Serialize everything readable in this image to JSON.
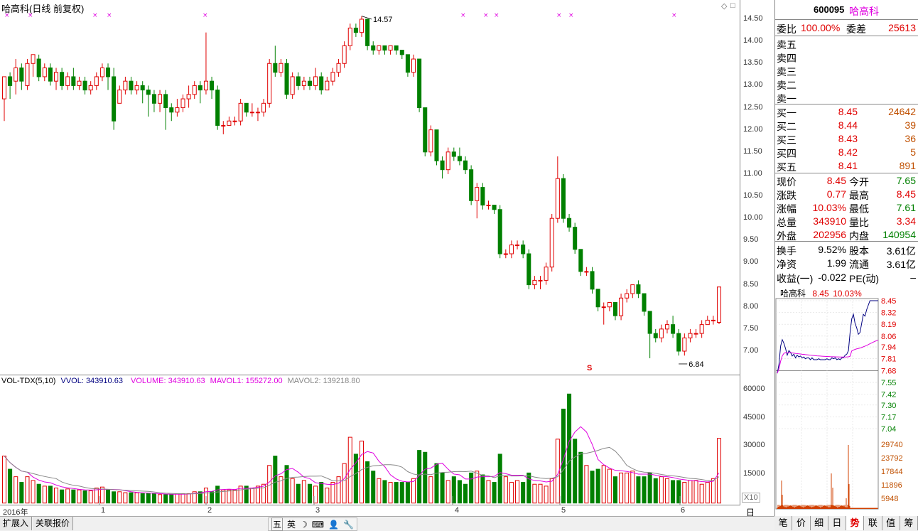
{
  "header": {
    "title": "哈高科(日线 前复权)"
  },
  "price_ticks": [
    "14.50",
    "14.00",
    "13.50",
    "13.00",
    "12.50",
    "12.00",
    "11.50",
    "11.00",
    "10.50",
    "10.00",
    "9.50",
    "9.00",
    "8.50",
    "8.00",
    "7.50",
    "7.00"
  ],
  "annotations": {
    "high": "14.57",
    "low": "6.84",
    "marker": "S"
  },
  "volume_header": {
    "name": "VOL-TDX(5,10)",
    "vvol": "VVOL: 343910.63",
    "volume": "VOLUME: 343910.63",
    "mavol1": "MAVOL1: 155272.00",
    "mavol2": "MAVOL2: 139218.80"
  },
  "vol_ticks": [
    "60000",
    "45000",
    "30000",
    "15000"
  ],
  "x10_label": "X10",
  "xaxis": [
    "2016年",
    "1",
    "2",
    "3",
    "4",
    "5",
    "6"
  ],
  "period_label": "日线",
  "bottom_tabs": [
    "扩展入",
    "关联报价"
  ],
  "ime": [
    "五",
    "英",
    "☽",
    "⌨",
    "👤",
    "🔧"
  ],
  "quote": {
    "code": "600095",
    "name": "哈高科",
    "weibi_label": "委比",
    "weibi": "100.00%",
    "weicha_label": "委差",
    "weicha": "25613",
    "sell": [
      {
        "label": "卖五"
      },
      {
        "label": "卖四"
      },
      {
        "label": "卖三"
      },
      {
        "label": "卖二"
      },
      {
        "label": "卖一"
      }
    ],
    "buy": [
      {
        "label": "买一",
        "price": "8.45",
        "vol": "24642"
      },
      {
        "label": "买二",
        "price": "8.44",
        "vol": "39"
      },
      {
        "label": "买三",
        "price": "8.43",
        "vol": "36"
      },
      {
        "label": "买四",
        "price": "8.42",
        "vol": "5"
      },
      {
        "label": "买五",
        "price": "8.41",
        "vol": "891"
      }
    ],
    "stats": [
      {
        "l1": "现价",
        "v1": "8.45",
        "c1": "red",
        "l2": "今开",
        "v2": "7.65",
        "c2": "green"
      },
      {
        "l1": "涨跌",
        "v1": "0.77",
        "c1": "red",
        "l2": "最高",
        "v2": "8.45",
        "c2": "red"
      },
      {
        "l1": "涨幅",
        "v1": "10.03%",
        "c1": "red",
        "l2": "最低",
        "v2": "7.61",
        "c2": "green"
      },
      {
        "l1": "总量",
        "v1": "343910",
        "c1": "red",
        "l2": "量比",
        "v2": "3.34",
        "c2": "red"
      },
      {
        "l1": "外盘",
        "v1": "202956",
        "c1": "red",
        "l2": "内盘",
        "v2": "140954",
        "c2": "green"
      },
      {
        "l1": "换手",
        "v1": "9.52%",
        "c1": "black",
        "l2": "股本",
        "v2": "3.61亿",
        "c2": "black"
      },
      {
        "l1": "净资",
        "v1": "1.99",
        "c1": "black",
        "l2": "流通",
        "v2": "3.61亿",
        "c2": "black"
      },
      {
        "l1": "收益(一)",
        "v1": "-0.022",
        "c1": "black",
        "l2": "PE(动)",
        "v2": "–",
        "c2": "black"
      }
    ]
  },
  "mini": {
    "name": "哈高科",
    "price": "8.45",
    "pct": "10.03%",
    "price_ticks": [
      "8.45",
      "8.32",
      "8.19",
      "8.06",
      "7.94",
      "7.81",
      "7.68",
      "7.55",
      "7.42",
      "7.30",
      "7.17",
      "7.04"
    ],
    "vol_ticks": [
      "29740",
      "23792",
      "17844",
      "11896",
      "5948"
    ]
  },
  "side_tabs": [
    "笔",
    "价",
    "细",
    "日",
    "势",
    "联",
    "值",
    "筹"
  ],
  "colors": {
    "up": "#e00000",
    "down": "#008000",
    "ma1": "#e000e0",
    "ma2": "#888888"
  },
  "chart_data": {
    "type": "candlestick",
    "ylim": [
      6.6,
      14.7
    ],
    "candles": [
      [
        12.7,
        13.2,
        12.2,
        13.2
      ],
      [
        13.2,
        13.0,
        12.7,
        13.3
      ],
      [
        13.1,
        13.4,
        12.8,
        13.6
      ],
      [
        13.4,
        13.1,
        12.9,
        13.5
      ],
      [
        13.0,
        13.5,
        12.9,
        13.6
      ],
      [
        13.5,
        13.7,
        13.2,
        13.7
      ],
      [
        13.6,
        13.2,
        13.1,
        13.7
      ],
      [
        13.2,
        13.4,
        13.1,
        13.5
      ],
      [
        13.4,
        13.1,
        13.0,
        13.5
      ],
      [
        13.1,
        13.3,
        12.9,
        13.4
      ],
      [
        13.3,
        13.0,
        12.9,
        13.4
      ],
      [
        13.0,
        13.2,
        12.9,
        13.3
      ],
      [
        13.2,
        13.0,
        12.9,
        13.4
      ],
      [
        13.0,
        13.1,
        12.9,
        13.2
      ],
      [
        13.1,
        12.9,
        12.8,
        13.2
      ],
      [
        12.9,
        13.0,
        12.8,
        13.1
      ],
      [
        13.0,
        13.2,
        12.9,
        13.3
      ],
      [
        13.2,
        13.4,
        13.1,
        13.5
      ],
      [
        13.4,
        13.2,
        12.9,
        13.5
      ],
      [
        13.2,
        12.2,
        12.0,
        13.4
      ],
      [
        12.6,
        12.9,
        12.6,
        13.0
      ],
      [
        12.9,
        13.1,
        12.8,
        13.2
      ],
      [
        13.1,
        12.9,
        12.8,
        13.2
      ],
      [
        12.9,
        13.0,
        12.8,
        13.1
      ],
      [
        13.0,
        12.9,
        12.6,
        13.1
      ],
      [
        12.9,
        12.8,
        12.3,
        13.0
      ],
      [
        12.8,
        12.6,
        12.4,
        12.9
      ],
      [
        12.6,
        12.8,
        12.4,
        12.9
      ],
      [
        12.8,
        12.5,
        12.0,
        12.9
      ],
      [
        12.5,
        12.4,
        12.2,
        12.6
      ],
      [
        12.4,
        12.5,
        12.3,
        12.7
      ],
      [
        12.5,
        12.7,
        12.4,
        12.8
      ],
      [
        12.7,
        12.8,
        12.5,
        13.0
      ],
      [
        12.8,
        13.0,
        12.7,
        13.1
      ],
      [
        13.0,
        12.9,
        12.6,
        13.1
      ],
      [
        12.9,
        13.1,
        12.8,
        14.2
      ],
      [
        13.1,
        12.9,
        12.7,
        13.2
      ],
      [
        12.9,
        12.1,
        12.0,
        13.0
      ],
      [
        12.1,
        12.1,
        11.9,
        12.2
      ],
      [
        12.1,
        12.2,
        12.1,
        12.3
      ],
      [
        12.2,
        12.2,
        12.1,
        12.3
      ],
      [
        12.2,
        12.6,
        12.1,
        12.7
      ],
      [
        12.6,
        12.4,
        12.3,
        12.6
      ],
      [
        12.4,
        12.4,
        12.3,
        12.6
      ],
      [
        12.4,
        12.4,
        12.2,
        12.5
      ],
      [
        12.4,
        12.6,
        12.3,
        12.7
      ],
      [
        12.6,
        13.5,
        12.5,
        13.6
      ],
      [
        13.5,
        13.3,
        13.2,
        13.9
      ],
      [
        13.3,
        13.5,
        13.2,
        13.6
      ],
      [
        13.5,
        12.8,
        12.7,
        13.6
      ],
      [
        12.8,
        13.2,
        12.7,
        13.3
      ],
      [
        13.2,
        13.0,
        12.9,
        13.3
      ],
      [
        13.0,
        13.1,
        12.9,
        13.2
      ],
      [
        13.1,
        13.0,
        12.9,
        13.2
      ],
      [
        13.0,
        13.2,
        12.9,
        13.4
      ],
      [
        13.2,
        12.9,
        12.8,
        13.3
      ],
      [
        12.9,
        13.1,
        12.9,
        13.2
      ],
      [
        13.1,
        13.3,
        13.0,
        13.4
      ],
      [
        13.3,
        13.5,
        13.2,
        13.6
      ],
      [
        13.5,
        13.9,
        13.4,
        14.0
      ],
      [
        13.9,
        14.3,
        13.8,
        14.4
      ],
      [
        14.3,
        14.2,
        14.1,
        14.4
      ],
      [
        14.2,
        14.5,
        14.1,
        14.57
      ],
      [
        14.5,
        13.9,
        13.8,
        14.5
      ],
      [
        13.9,
        13.8,
        13.7,
        14.0
      ],
      [
        13.8,
        13.9,
        13.7,
        13.9
      ],
      [
        13.9,
        13.8,
        13.7,
        13.9
      ],
      [
        13.8,
        13.9,
        13.7,
        13.9
      ],
      [
        13.9,
        13.8,
        13.7,
        13.9
      ],
      [
        13.8,
        13.7,
        13.6,
        13.8
      ],
      [
        13.7,
        13.3,
        13.2,
        13.7
      ],
      [
        13.3,
        13.6,
        13.2,
        13.7
      ],
      [
        13.6,
        12.5,
        12.4,
        13.6
      ],
      [
        12.5,
        11.5,
        11.4,
        12.5
      ],
      [
        11.5,
        12.0,
        11.4,
        12.1
      ],
      [
        12.0,
        11.3,
        11.2,
        12.0
      ],
      [
        11.3,
        11.1,
        10.9,
        11.4
      ],
      [
        11.1,
        11.5,
        11.0,
        11.6
      ],
      [
        11.5,
        11.4,
        11.3,
        11.6
      ],
      [
        11.4,
        11.3,
        11.2,
        11.6
      ],
      [
        11.3,
        11.1,
        11.0,
        11.4
      ],
      [
        11.1,
        10.4,
        10.3,
        11.2
      ],
      [
        10.4,
        10.7,
        10.0,
        10.8
      ],
      [
        10.7,
        10.3,
        10.2,
        10.8
      ],
      [
        10.3,
        10.3,
        10.2,
        10.4
      ],
      [
        10.3,
        10.2,
        10.1,
        10.3
      ],
      [
        10.2,
        9.2,
        9.1,
        10.3
      ],
      [
        9.2,
        9.2,
        9.1,
        9.3
      ],
      [
        9.2,
        9.4,
        9.1,
        9.5
      ],
      [
        9.4,
        9.4,
        9.3,
        9.5
      ],
      [
        9.4,
        9.2,
        9.1,
        9.5
      ],
      [
        9.2,
        8.5,
        8.4,
        9.3
      ],
      [
        8.5,
        8.6,
        8.4,
        8.7
      ],
      [
        8.6,
        8.6,
        8.4,
        8.7
      ],
      [
        8.6,
        8.9,
        8.5,
        9.0
      ],
      [
        8.9,
        10.0,
        8.8,
        10.1
      ],
      [
        10.0,
        10.9,
        9.9,
        11.4
      ],
      [
        10.9,
        10.0,
        9.9,
        11.0
      ],
      [
        10.0,
        9.8,
        9.7,
        10.1
      ],
      [
        9.8,
        9.3,
        9.2,
        9.9
      ],
      [
        9.3,
        8.8,
        8.7,
        9.3
      ],
      [
        8.8,
        8.8,
        8.7,
        8.9
      ],
      [
        8.8,
        8.4,
        8.3,
        8.9
      ],
      [
        8.4,
        8.0,
        7.9,
        8.4
      ],
      [
        8.0,
        8.0,
        7.6,
        8.1
      ],
      [
        8.0,
        8.1,
        7.9,
        8.1
      ],
      [
        8.1,
        7.8,
        7.7,
        8.1
      ],
      [
        7.8,
        8.2,
        7.7,
        8.3
      ],
      [
        8.2,
        8.3,
        8.1,
        8.4
      ],
      [
        8.3,
        8.5,
        8.2,
        8.5
      ],
      [
        8.5,
        8.3,
        8.2,
        8.6
      ],
      [
        8.3,
        7.9,
        7.8,
        8.3
      ],
      [
        7.9,
        7.4,
        6.84,
        7.9
      ],
      [
        7.4,
        7.3,
        7.2,
        7.5
      ],
      [
        7.3,
        7.5,
        7.2,
        7.6
      ],
      [
        7.5,
        7.6,
        7.4,
        7.7
      ],
      [
        7.6,
        7.4,
        7.3,
        7.8
      ],
      [
        7.4,
        7.0,
        6.9,
        7.5
      ],
      [
        7.0,
        7.3,
        6.9,
        7.4
      ],
      [
        7.3,
        7.4,
        7.2,
        7.5
      ],
      [
        7.4,
        7.4,
        7.3,
        7.5
      ],
      [
        7.4,
        7.6,
        7.3,
        7.7
      ],
      [
        7.6,
        7.7,
        7.6,
        7.8
      ],
      [
        7.7,
        7.7,
        7.6,
        7.8
      ],
      [
        7.65,
        8.45,
        7.61,
        8.45
      ]
    ],
    "volumes": [
      25000,
      18000,
      14000,
      11000,
      14000,
      12000,
      10000,
      9000,
      9000,
      8000,
      7000,
      7500,
      7000,
      7000,
      6500,
      6500,
      8000,
      8500,
      7000,
      6000,
      6000,
      5500,
      5500,
      5500,
      5000,
      5000,
      5000,
      4500,
      4500,
      4500,
      5000,
      5000,
      5000,
      6000,
      6000,
      8000,
      6000,
      9000,
      7000,
      7000,
      7000,
      9000,
      9000,
      8000,
      9000,
      10000,
      20000,
      25000,
      14000,
      20000,
      13000,
      10000,
      12000,
      10000,
      9000,
      11000,
      8000,
      11000,
      14000,
      21000,
      35000,
      26000,
      33000,
      22000,
      17000,
      13000,
      12000,
      11000,
      11000,
      11000,
      11000,
      13000,
      28000,
      27000,
      14000,
      21000,
      16000,
      12000,
      14000,
      12000,
      10000,
      16000,
      17000,
      15000,
      12000,
      11000,
      26000,
      14000,
      11000,
      12000,
      11000,
      16000,
      10000,
      10000,
      9000,
      13000,
      34000,
      50000,
      58000,
      34000,
      27000,
      20000,
      17000,
      18000,
      20000,
      18000,
      14000,
      16000,
      16000,
      17000,
      14000,
      14000,
      16000,
      13000,
      14000,
      13000,
      12000,
      12000,
      11000,
      12000,
      12000,
      10000,
      11000,
      13000,
      34391
    ]
  }
}
